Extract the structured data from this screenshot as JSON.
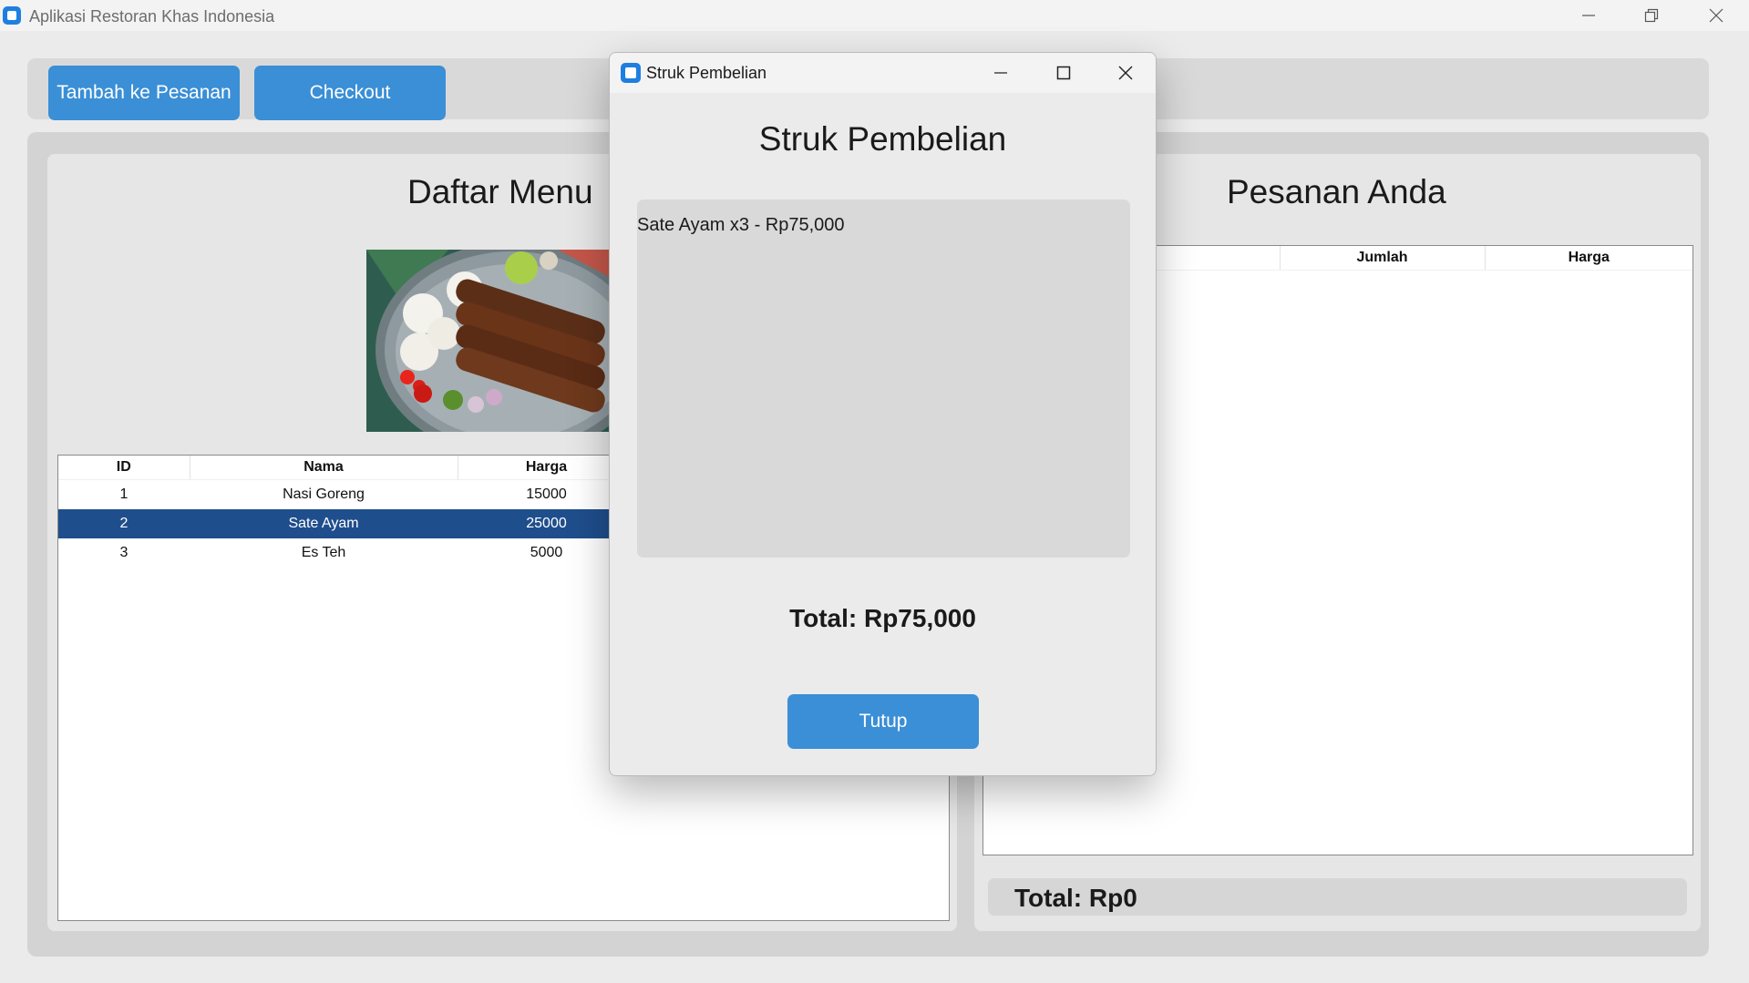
{
  "window": {
    "title": "Aplikasi Restoran Khas Indonesia"
  },
  "toolbar": {
    "add_label": "Tambah ke Pesanan",
    "checkout_label": "Checkout"
  },
  "menu": {
    "title": "Daftar Menu",
    "columns": [
      "ID",
      "Nama",
      "Harga"
    ],
    "rows": [
      {
        "id": "1",
        "name": "Nasi Goreng",
        "price": "15000"
      },
      {
        "id": "2",
        "name": "Sate Ayam",
        "price": "25000"
      },
      {
        "id": "3",
        "name": "Es Teh",
        "price": "5000"
      }
    ]
  },
  "order": {
    "title": "Pesanan Anda",
    "columns": [
      "Jumlah",
      "Harga"
    ],
    "total": "Total: Rp0"
  },
  "dialog": {
    "window_title": "Struk Pembelian",
    "heading": "Struk Pembelian",
    "line_item": "Sate Ayam x3 - Rp75,000",
    "total": "Total: Rp75,000",
    "close_label": "Tutup"
  },
  "colors": {
    "accent": "#3a8fd6",
    "selection": "#1f4e8c"
  }
}
